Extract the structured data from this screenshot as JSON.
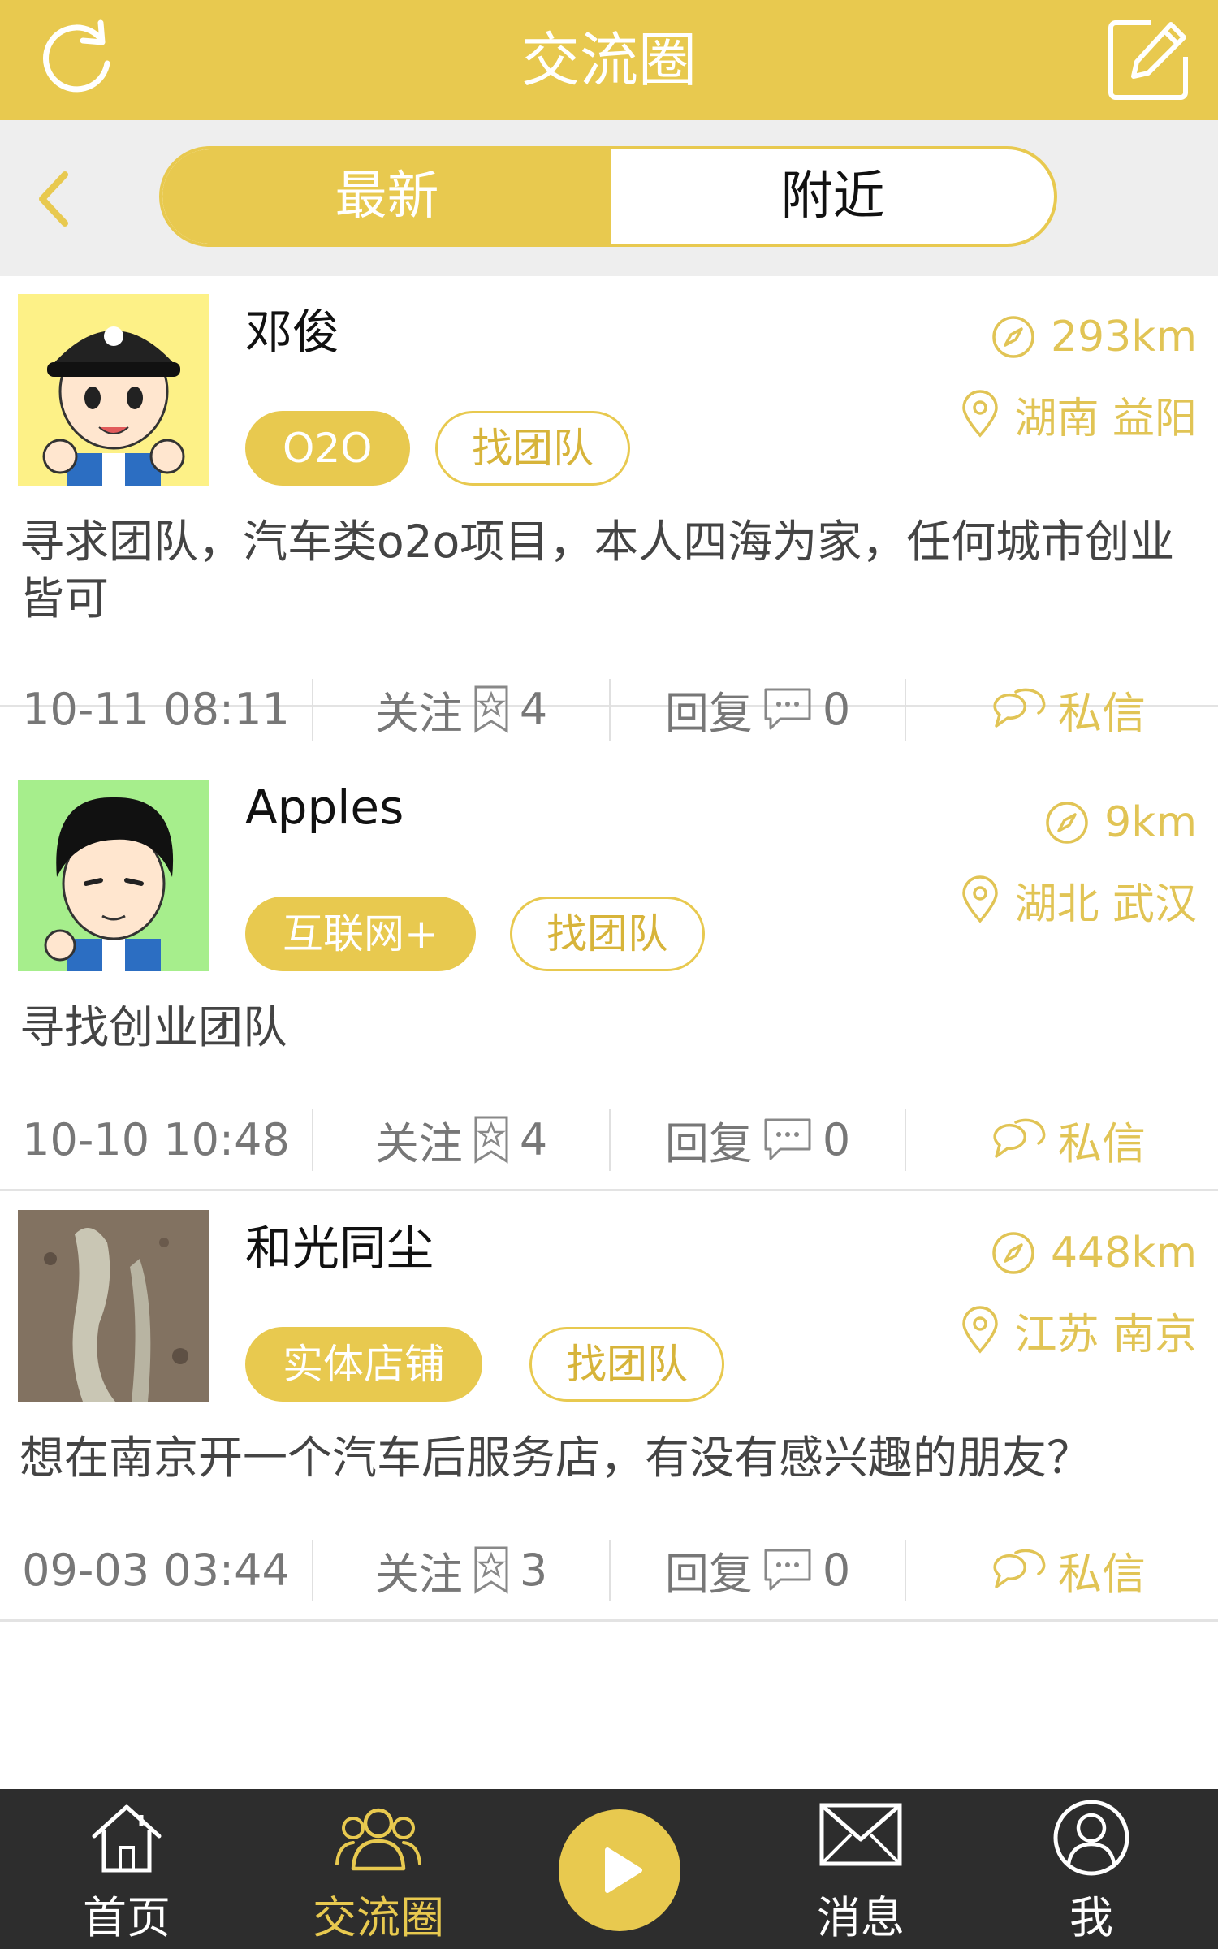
{
  "header": {
    "title": "交流圈"
  },
  "tabs": {
    "latest": "最新",
    "nearby": "附近"
  },
  "posts": [
    {
      "name": "邓俊",
      "distance": "293km",
      "location": "湖南 益阳",
      "category_tag": "O2O",
      "type_tag": "找团队",
      "content": "寻求团队，汽车类o2o项目，本人四海为家，任何城市创业皆可",
      "time": "10-11 08:11",
      "follow_label": "关注",
      "follow_count": "4",
      "reply_label": "回复",
      "reply_count": "0",
      "message_label": "私信"
    },
    {
      "name": "Apples",
      "distance": "9km",
      "location": "湖北 武汉",
      "category_tag": "互联网+",
      "type_tag": "找团队",
      "content": "寻找创业团队",
      "time": "10-10 10:48",
      "follow_label": "关注",
      "follow_count": "4",
      "reply_label": "回复",
      "reply_count": "0",
      "message_label": "私信"
    },
    {
      "name": "和光同尘",
      "distance": "448km",
      "location": "江苏 南京",
      "category_tag": "实体店铺",
      "type_tag": "找团队",
      "content": "想在南京开一个汽车后服务店，有没有感兴趣的朋友？",
      "time": "09-03 03:44",
      "follow_label": "关注",
      "follow_count": "3",
      "reply_label": "回复",
      "reply_count": "0",
      "message_label": "私信"
    }
  ],
  "bottom_nav": {
    "home": "首页",
    "circle": "交流圈",
    "messages": "消息",
    "me": "我"
  },
  "colors": {
    "accent": "#e8c94f",
    "accent_text": "#e1c455",
    "nav_bg": "#2d2d2d"
  }
}
